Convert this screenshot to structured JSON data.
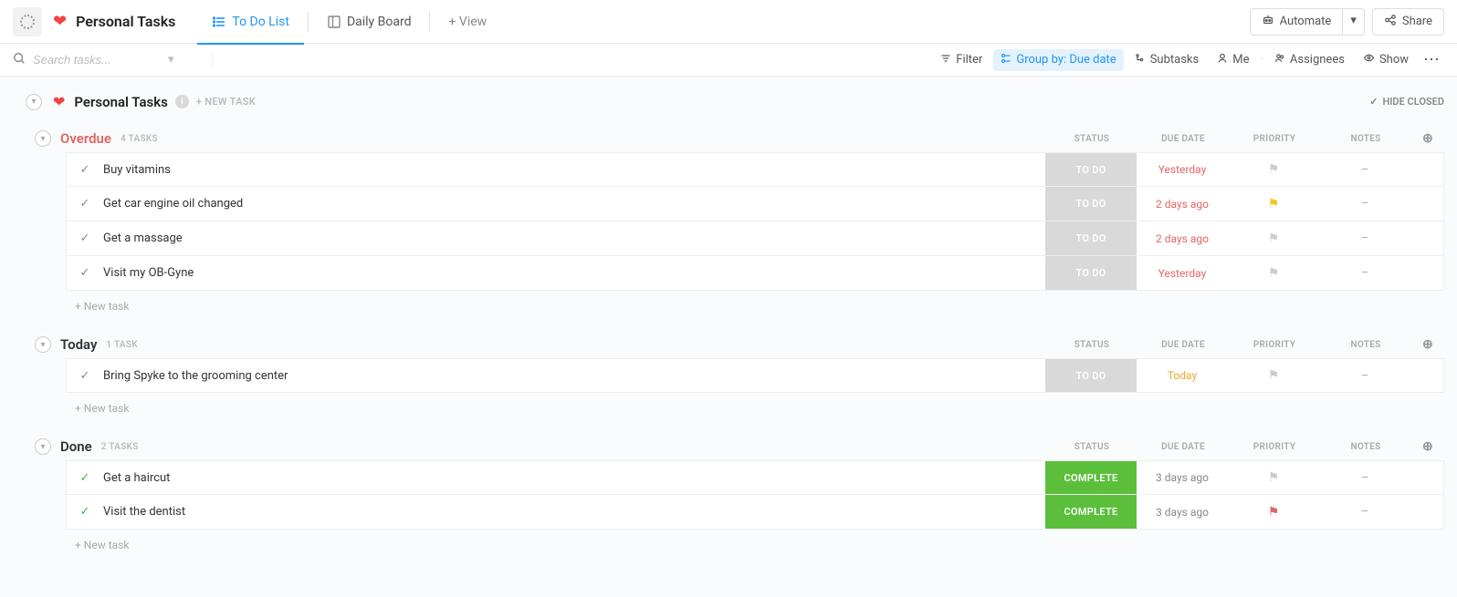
{
  "header": {
    "project_title": "Personal Tasks",
    "views": {
      "tab_todo": "To Do List",
      "tab_board": "Daily Board",
      "add_view": "+  View"
    },
    "automate": "Automate",
    "share": "Share"
  },
  "filterbar": {
    "search_placeholder": "Search tasks...",
    "filter": "Filter",
    "group_by": "Group by: Due date",
    "subtasks": "Subtasks",
    "me": "Me",
    "assignees": "Assignees",
    "show": "Show"
  },
  "list_header": {
    "title": "Personal Tasks",
    "new_task": "+ NEW TASK",
    "hide_closed": "HIDE CLOSED"
  },
  "columns": {
    "status": "STATUS",
    "due": "DUE DATE",
    "priority": "PRIORITY",
    "notes": "NOTES"
  },
  "new_task_row": "+ New task",
  "groups": [
    {
      "name": "Overdue",
      "name_color": "#e06666",
      "count": "4 TASKS",
      "tasks": [
        {
          "name": "Buy vitamins",
          "status": "TO DO",
          "status_class": "status-todo",
          "due": "Yesterday",
          "due_class": "due-red",
          "flag_class": "flag-gray",
          "flag_char": "⚑",
          "done": false
        },
        {
          "name": "Get car engine oil changed",
          "status": "TO DO",
          "status_class": "status-todo",
          "due": "2 days ago",
          "due_class": "due-red",
          "flag_class": "flag-yellow",
          "flag_char": "⚑",
          "done": false
        },
        {
          "name": "Get a massage",
          "status": "TO DO",
          "status_class": "status-todo",
          "due": "2 days ago",
          "due_class": "due-red",
          "flag_class": "flag-gray",
          "flag_char": "⚑",
          "done": false
        },
        {
          "name": "Visit my OB-Gyne",
          "status": "TO DO",
          "status_class": "status-todo",
          "due": "Yesterday",
          "due_class": "due-red",
          "flag_class": "flag-gray",
          "flag_char": "⚑",
          "done": false
        }
      ]
    },
    {
      "name": "Today",
      "name_color": "#333",
      "count": "1 TASK",
      "tasks": [
        {
          "name": "Bring Spyke to the grooming center",
          "status": "TO DO",
          "status_class": "status-todo",
          "due": "Today",
          "due_class": "due-orange",
          "flag_class": "flag-gray",
          "flag_char": "⚑",
          "done": false
        }
      ]
    },
    {
      "name": "Done",
      "name_color": "#333",
      "count": "2 TASKS",
      "tasks": [
        {
          "name": "Get a haircut",
          "status": "COMPLETE",
          "status_class": "status-complete",
          "due": "3 days ago",
          "due_class": "due-gray",
          "flag_class": "flag-gray",
          "flag_char": "⚑",
          "done": true
        },
        {
          "name": "Visit the dentist",
          "status": "COMPLETE",
          "status_class": "status-complete",
          "due": "3 days ago",
          "due_class": "due-gray",
          "flag_class": "flag-red",
          "flag_char": "⚑",
          "done": true
        }
      ]
    }
  ]
}
